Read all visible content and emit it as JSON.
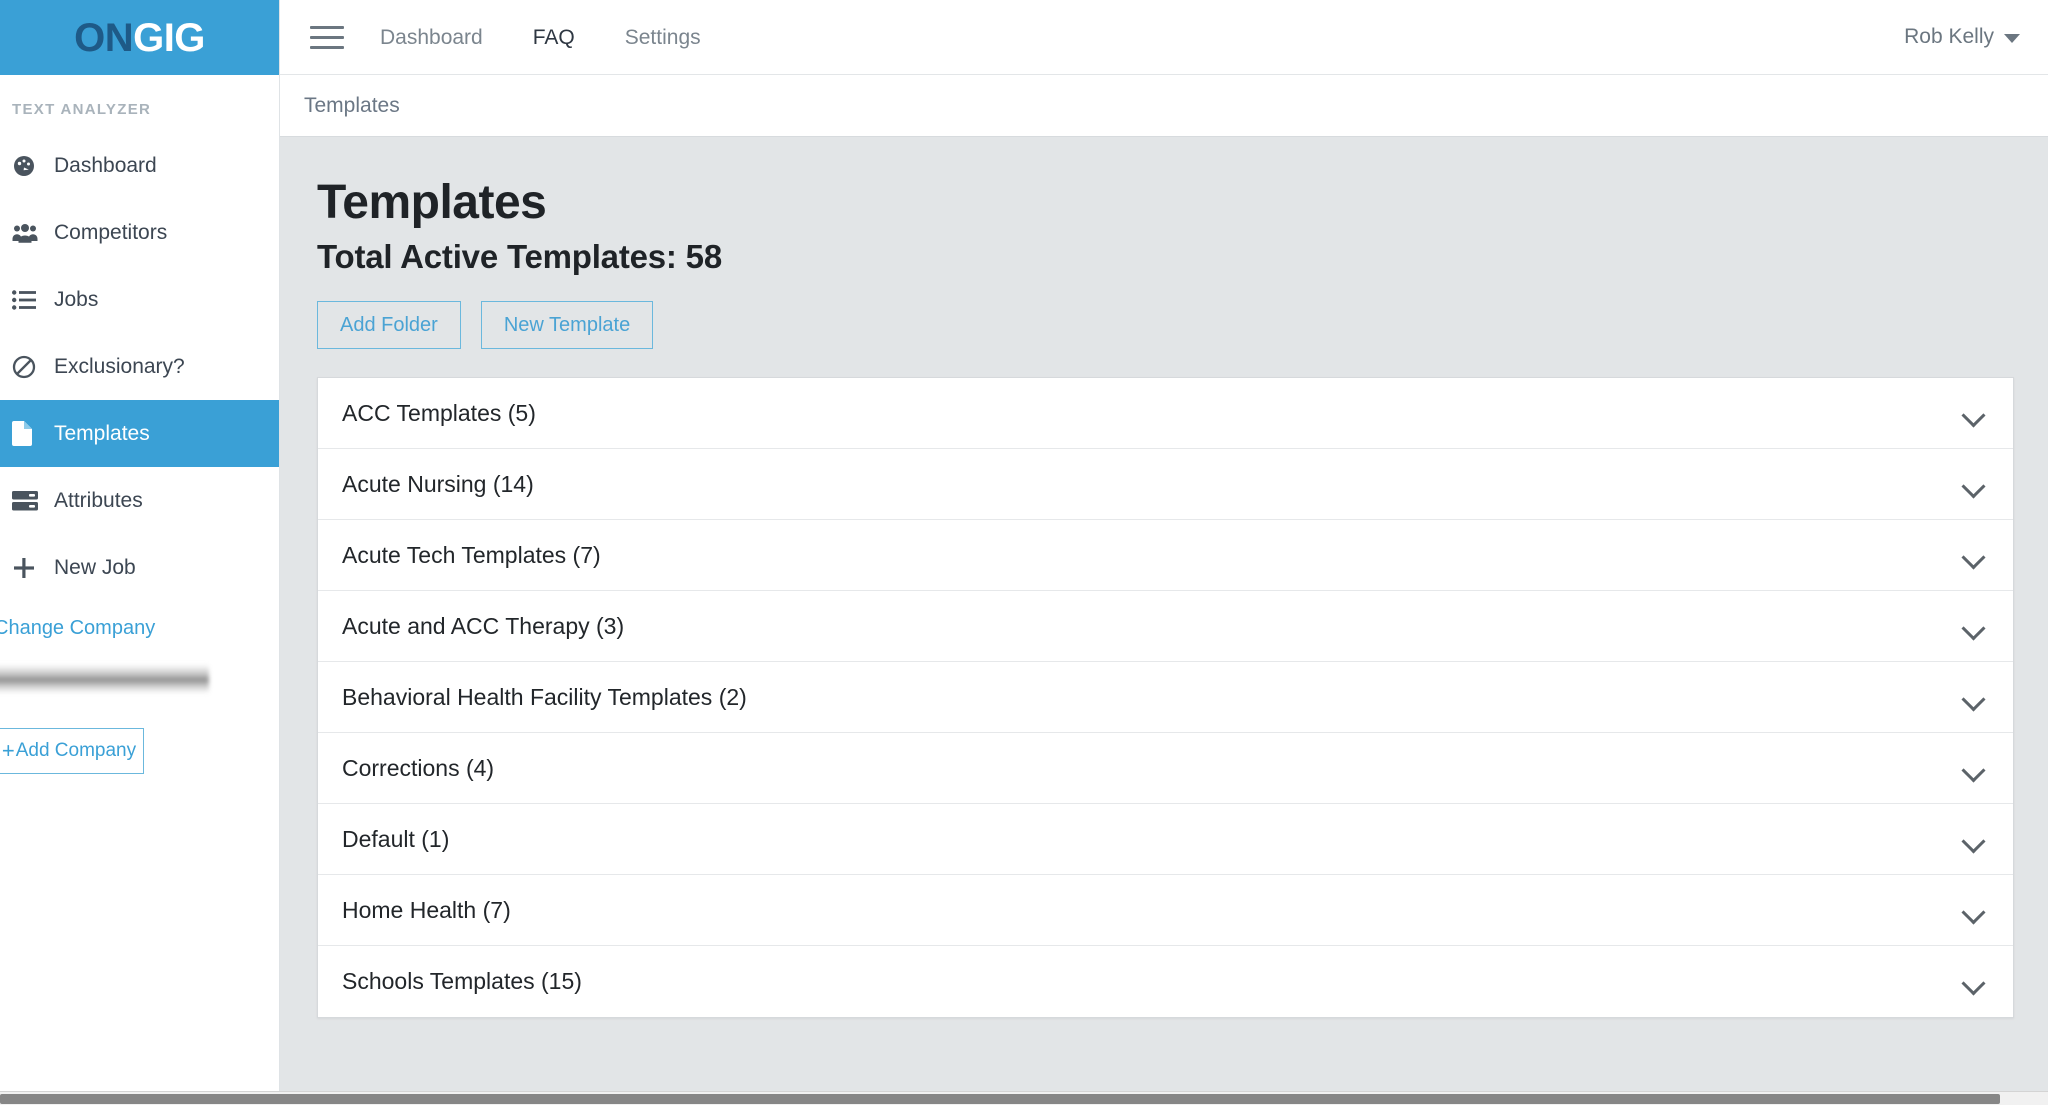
{
  "brand": {
    "logo_part1": "ON",
    "logo_part2": "GIG",
    "accent_color": "#3aa0d6",
    "logo_dark_color": "#1e5a87"
  },
  "topbar": {
    "menu_icon": "hamburger-icon",
    "nav": [
      {
        "label": "Dashboard",
        "active": false
      },
      {
        "label": "FAQ",
        "active": true
      },
      {
        "label": "Settings",
        "active": false
      }
    ],
    "user": {
      "name": "Rob Kelly",
      "caret_icon": "chevron-down-icon"
    }
  },
  "breadcrumb": {
    "current": "Templates"
  },
  "sidebar": {
    "section_title": "TEXT ANALYZER",
    "items": [
      {
        "label": "Dashboard",
        "icon": "tachometer-icon",
        "active": false
      },
      {
        "label": "Competitors",
        "icon": "users-icon",
        "active": false
      },
      {
        "label": "Jobs",
        "icon": "list-icon",
        "active": false
      },
      {
        "label": "Exclusionary?",
        "icon": "ban-icon",
        "active": false
      },
      {
        "label": "Templates",
        "icon": "file-icon",
        "active": true
      },
      {
        "label": "Attributes",
        "icon": "server-icon",
        "active": false
      },
      {
        "label": "New Job",
        "icon": "plus-icon",
        "active": false
      }
    ],
    "change_company_label": "Change Company",
    "company_name_redacted": "",
    "add_company_label": "Add Company",
    "add_company_plus": "+"
  },
  "main": {
    "title": "Templates",
    "subtitle": "Total Active Templates: 58",
    "total_active_templates": 58,
    "buttons": [
      {
        "label": "Add Folder"
      },
      {
        "label": "New Template"
      }
    ],
    "folders": [
      {
        "label": "ACC Templates (5)",
        "name": "ACC Templates",
        "count": 5,
        "chevron": "chevron-down-icon"
      },
      {
        "label": "Acute Nursing (14)",
        "name": "Acute Nursing",
        "count": 14,
        "chevron": "chevron-down-icon"
      },
      {
        "label": "Acute Tech Templates (7)",
        "name": "Acute Tech Templates",
        "count": 7,
        "chevron": "chevron-down-icon"
      },
      {
        "label": "Acute and ACC Therapy (3)",
        "name": "Acute and ACC Therapy",
        "count": 3,
        "chevron": "chevron-down-icon"
      },
      {
        "label": "Behavioral Health Facility Templates (2)",
        "name": "Behavioral Health Facility Templates",
        "count": 2,
        "chevron": "chevron-down-icon"
      },
      {
        "label": "Corrections (4)",
        "name": "Corrections",
        "count": 4,
        "chevron": "chevron-down-icon"
      },
      {
        "label": "Default (1)",
        "name": "Default",
        "count": 1,
        "chevron": "chevron-down-icon"
      },
      {
        "label": "Home Health (7)",
        "name": "Home Health",
        "count": 7,
        "chevron": "chevron-down-icon"
      },
      {
        "label": "Schools Templates (15)",
        "name": "Schools Templates",
        "count": 15,
        "chevron": "chevron-down-icon"
      }
    ]
  }
}
